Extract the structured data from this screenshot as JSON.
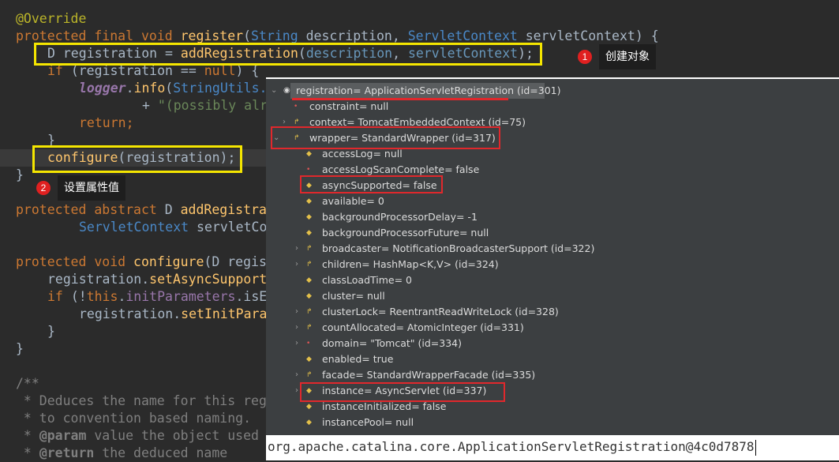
{
  "code": {
    "l1": "@Override",
    "l2": {
      "kw": "protected final void ",
      "fn": "register",
      "p1": "(",
      "t1": "String",
      "v1": " description, ",
      "t2": "ServletContext",
      "v2": " servletContext) {"
    },
    "l3": {
      "t": "D ",
      "v": "registration = ",
      "fn": "addRegistration",
      "rest1": "(",
      "a1": "description",
      "c": ", ",
      "a2": "servletContext",
      "end": ");"
    },
    "l4": {
      "kw": "if ",
      "rest": "(registration == ",
      "nl": "null",
      "end": ") {"
    },
    "l5": {
      "lg": "logger",
      "dot": ".",
      "info": "info",
      "p": "(",
      "su": "StringUtils."
    },
    "l6": {
      "plus": "+ ",
      "str": "\"(possibly alr"
    },
    "l7": "return;",
    "l8": "}",
    "l9": {
      "fn": "configure",
      "rest": "(registration);"
    },
    "l10": "}",
    "l11": {
      "kw": "protected abstract ",
      "t": "D ",
      "fn": "addRegistra"
    },
    "l12": {
      "t": "ServletContext",
      "v": " servletCo"
    },
    "l13": {
      "kw": "protected void ",
      "fn": "configure",
      "p": "(D regis"
    },
    "l14": {
      "v": "registration.",
      "fn": "setAsyncSupport"
    },
    "l15": {
      "kw": "if ",
      "p": "(!",
      "th": "this",
      "d": ".",
      "f": "initParameters",
      "rest": ".isE"
    },
    "l16": {
      "v": "registration.",
      "fn": "setInitPara"
    },
    "l17": "}",
    "l18": "}",
    "c1": "/**",
    "c2": " * Deduces the name for this reg",
    "c3": " * to convention based naming.",
    "c4": {
      "star": " * ",
      "tag": "@param",
      "rest": " value the object used"
    },
    "c5": {
      "star": " * ",
      "tag": "@return",
      "rest": " the deduced name"
    }
  },
  "annotations": {
    "badge1": "1",
    "label1": "创建对象",
    "badge2": "2",
    "label2": "设置属性值"
  },
  "debugger": {
    "root": "registration= ApplicationServletRegistration  (id=301)",
    "rows": [
      "constraint= null",
      "context= TomcatEmbeddedContext  (id=75)",
      "wrapper= StandardWrapper  (id=317)",
      "accessLog= null",
      "accessLogScanComplete= false",
      "asyncSupported= false",
      "available= 0",
      "backgroundProcessorDelay= -1",
      "backgroundProcessorFuture= null",
      "broadcaster= NotificationBroadcasterSupport  (id=322)",
      "children= HashMap<K,V>  (id=324)",
      "classLoadTime= 0",
      "cluster= null",
      "clusterLock= ReentrantReadWriteLock  (id=328)",
      "countAllocated= AtomicInteger  (id=331)",
      "domain= \"Tomcat\" (id=334)",
      "enabled= true",
      "facade= StandardWrapperFacade  (id=335)",
      "instance= AsyncServlet  (id=337)",
      "instanceInitialized= false",
      "instancePool= null"
    ],
    "status": "org.apache.catalina.core.ApplicationServletRegistration@4c0d7878"
  }
}
